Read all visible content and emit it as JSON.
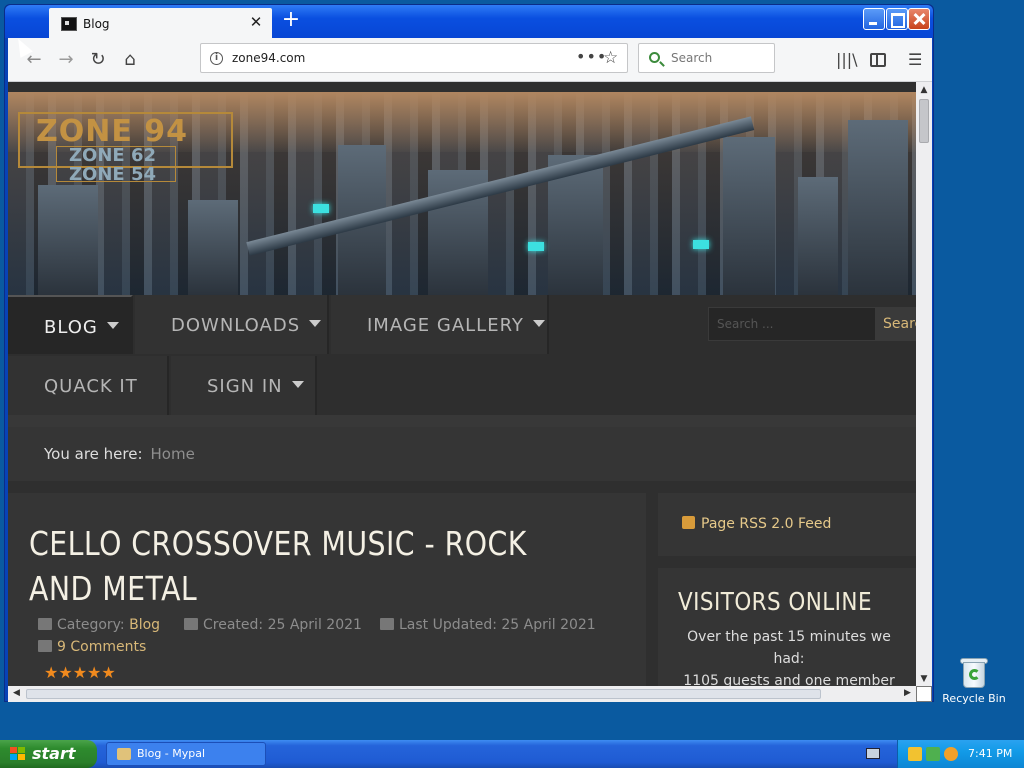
{
  "browser": {
    "tab_title": "Blog",
    "url": "zone94.com",
    "search_placeholder": "Search",
    "new_tab_symbol": "+",
    "tab_close_symbol": "✕"
  },
  "site": {
    "logo_main": "ZONE 94",
    "logo_sub1": "ZONE 62",
    "logo_sub2": "ZONE 54",
    "nav": [
      {
        "label": "BLOG",
        "dropdown": true,
        "active": true
      },
      {
        "label": "DOWNLOADS",
        "dropdown": true
      },
      {
        "label": "IMAGE GALLERY",
        "dropdown": true
      },
      {
        "label": "QUACK IT",
        "dropdown": false
      },
      {
        "label": "SIGN IN",
        "dropdown": true
      }
    ],
    "search_placeholder": "Search ...",
    "search_button": "Search",
    "breadcrumb_label": "You are here:",
    "breadcrumb_home": "Home"
  },
  "article": {
    "title": "CELLO CROSSOVER MUSIC - ROCK AND METAL",
    "category_label": "Category:",
    "category": "Blog",
    "created": "Created: 25 April 2021",
    "updated": "Last Updated: 25 April 2021",
    "comments": "9 Comments",
    "rating_stars": 5,
    "rating_symbol": "★★★★★"
  },
  "sidebar": {
    "rss": "Page RSS 2.0 Feed",
    "visitors_title": "VISITORS ONLINE",
    "visitors_line1": "Over the past 15 minutes we had:",
    "visitors_line2": "1105 guests and one member"
  },
  "desktop": {
    "recycle_bin": "Recycle Bin"
  },
  "taskbar": {
    "start": "start",
    "task_label": "Blog - Mypal",
    "clock": "7:41 PM"
  },
  "colors": {
    "accent_gold": "#d8b878",
    "page_bg": "#2f2f2f",
    "star_orange": "#f08a1e",
    "xp_blue": "#0842b6"
  }
}
